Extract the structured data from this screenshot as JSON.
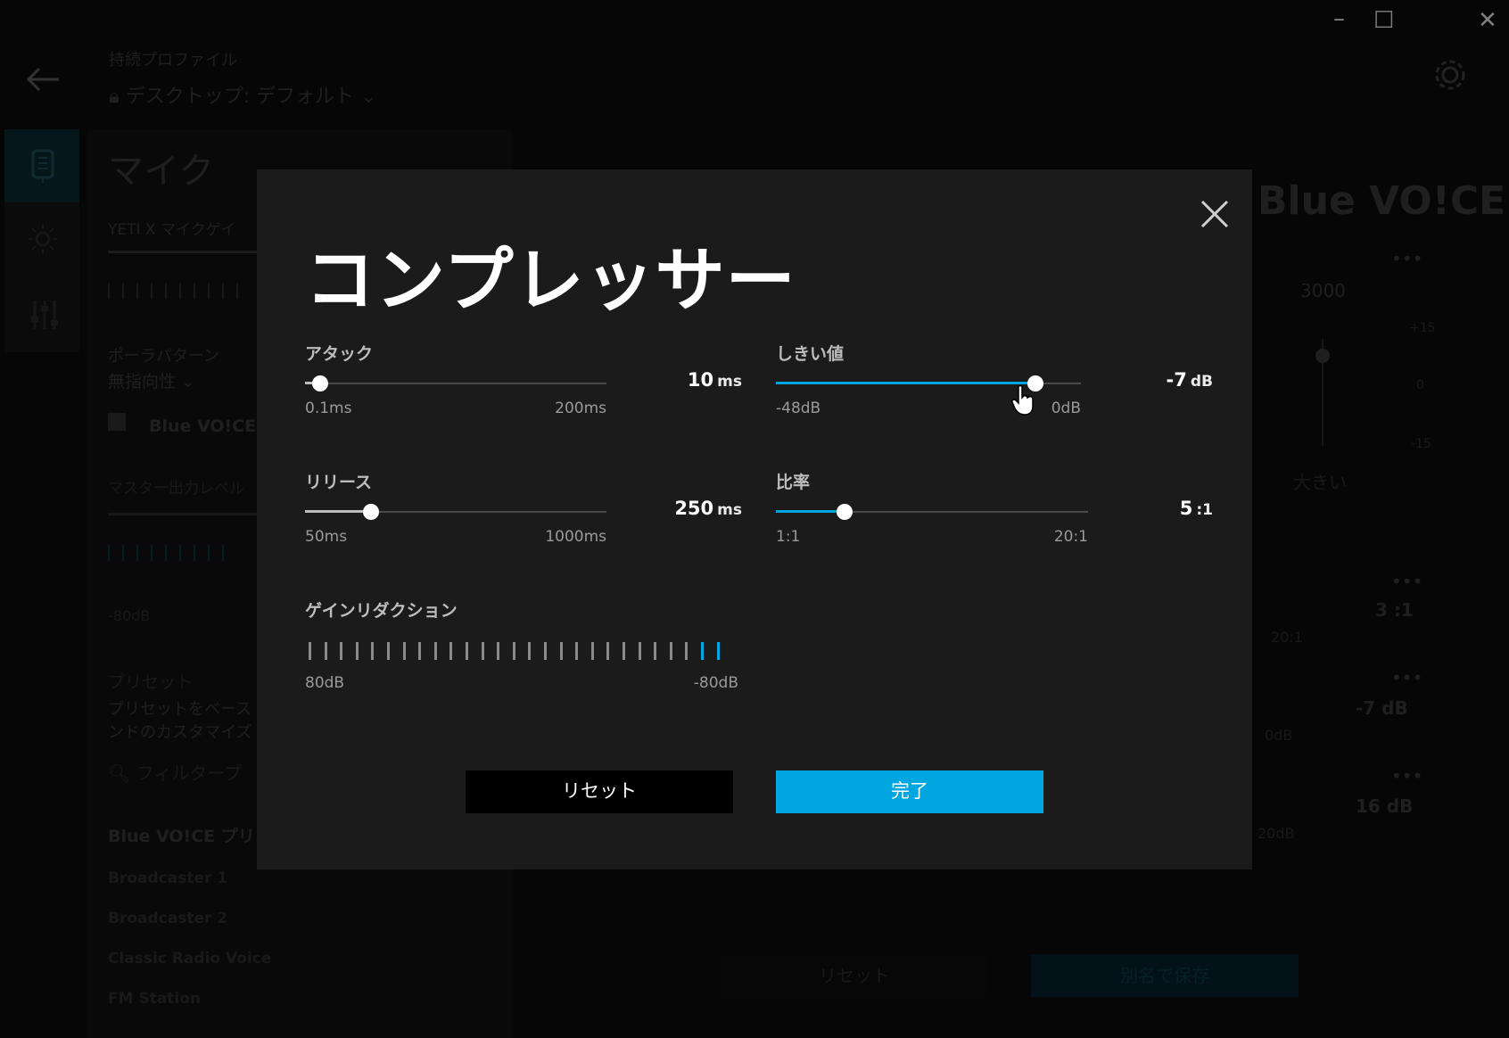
{
  "window": {
    "minimize": "–",
    "maximize": "☐",
    "close": "✕"
  },
  "background": {
    "profile_label": "持続プロファイル",
    "profile_value": "デスクトップ: デフォルト",
    "section_title": "マイク",
    "mic_gain_label": "YETI X マイクゲイ",
    "polar_label": "ポーラパターン",
    "polar_value": "無指向性",
    "blue_voice_checkbox": "Blue VO!CE を",
    "master_label": "マスター出力レベル",
    "master_min": "-80dB",
    "preset_heading": "プリセット",
    "preset_desc_1": "プリセットをベース",
    "preset_desc_2": "ンドのカスタマイズ",
    "filter_placeholder": "フィルタープ",
    "preset_group": "Blue VO!CE プリ",
    "presets": [
      "Broadcaster 1",
      "Broadcaster 2",
      "Classic Radio Voice",
      "FM Station"
    ],
    "brand": "Blue VO!CE",
    "freq_3000": "3000",
    "db_plus15": "+15",
    "db_0": "0",
    "db_minus15": "-15",
    "size_label": "大きい",
    "ratio_value_bg": "3 :1",
    "ratio_max_bg": "20:1",
    "threshold_value_bg": "-7 dB",
    "threshold_max_bg": "0dB",
    "gain_value_bg": "16 dB",
    "gain_max_bg": "20dB",
    "reset_button": "リセット",
    "save_as_button": "別名で保存"
  },
  "modal": {
    "title": "コンプレッサー",
    "attack": {
      "label": "アタック",
      "min": "0.1ms",
      "max": "200ms",
      "value": "10",
      "unit": "ms",
      "fraction": 0.05
    },
    "release": {
      "label": "リリース",
      "min": "50ms",
      "max": "1000ms",
      "value": "250",
      "unit": "ms",
      "fraction": 0.22
    },
    "threshold": {
      "label": "しきい値",
      "min": "-48dB",
      "max": "0dB",
      "value": "-7",
      "unit": "dB",
      "fraction": 0.85
    },
    "ratio": {
      "label": "比率",
      "min": "1:1",
      "max": "20:1",
      "value": "5",
      "unit": ":1",
      "fraction": 0.22
    },
    "gain_reduction": {
      "label": "ゲインリダクション",
      "left": "80dB",
      "right": "-80dB",
      "ticks": 27,
      "active_ticks": 2
    },
    "reset_button": "リセット",
    "done_button": "完了"
  },
  "colors": {
    "accent": "#00a6e0",
    "modal_bg": "#1b1b1b"
  }
}
